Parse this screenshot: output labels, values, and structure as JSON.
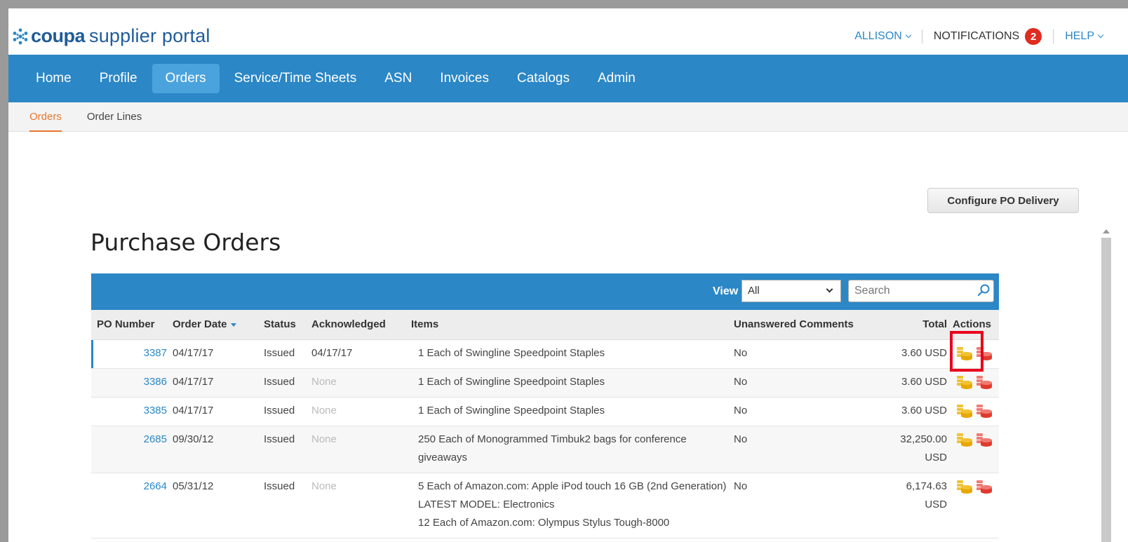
{
  "brand": {
    "logo_bold": "coupa",
    "logo_rest": "supplier portal"
  },
  "topnav": {
    "user": "ALLISON",
    "notifications_label": "NOTIFICATIONS",
    "notifications_count": "2",
    "help": "HELP"
  },
  "mainnav": {
    "tabs": [
      {
        "label": "Home",
        "active": false
      },
      {
        "label": "Profile",
        "active": false
      },
      {
        "label": "Orders",
        "active": true
      },
      {
        "label": "Service/Time Sheets",
        "active": false
      },
      {
        "label": "ASN",
        "active": false
      },
      {
        "label": "Invoices",
        "active": false
      },
      {
        "label": "Catalogs",
        "active": false
      },
      {
        "label": "Admin",
        "active": false
      }
    ]
  },
  "subnav": {
    "tabs": [
      {
        "label": "Orders",
        "active": true
      },
      {
        "label": "Order Lines",
        "active": false
      }
    ]
  },
  "configure_button": "Configure PO Delivery",
  "page_title": "Purchase Orders",
  "table": {
    "view_label": "View",
    "view_selected": "All",
    "search_placeholder": "Search",
    "columns": {
      "po_number": "PO Number",
      "order_date": "Order Date",
      "status": "Status",
      "acknowledged": "Acknowledged",
      "items": "Items",
      "unanswered": "Unanswered Comments",
      "total": "Total",
      "actions": "Actions"
    },
    "rows": [
      {
        "po": "3387",
        "date": "04/17/17",
        "status": "Issued",
        "ack": "04/17/17",
        "items": [
          "1 Each of Swingline Speedpoint Staples"
        ],
        "unanswered": "No",
        "total": "3.60 USD"
      },
      {
        "po": "3386",
        "date": "04/17/17",
        "status": "Issued",
        "ack": "None",
        "items": [
          "1 Each of Swingline Speedpoint Staples"
        ],
        "unanswered": "No",
        "total": "3.60 USD"
      },
      {
        "po": "3385",
        "date": "04/17/17",
        "status": "Issued",
        "ack": "None",
        "items": [
          "1 Each of Swingline Speedpoint Staples"
        ],
        "unanswered": "No",
        "total": "3.60 USD"
      },
      {
        "po": "2685",
        "date": "09/30/12",
        "status": "Issued",
        "ack": "None",
        "items": [
          "250 Each of Monogrammed Timbuk2 bags for conference giveaways"
        ],
        "unanswered": "No",
        "total": "32,250.00 USD"
      },
      {
        "po": "2664",
        "date": "05/31/12",
        "status": "Issued",
        "ack": "None",
        "items": [
          "5 Each of Amazon.com: Apple iPod touch 16 GB (2nd Generation) LATEST MODEL: Electronics",
          "12 Each of Amazon.com: Olympus Stylus Tough-8000"
        ],
        "unanswered": "No",
        "total": "6,174.63 USD"
      }
    ]
  },
  "colors": {
    "nav_blue": "#2b87c6",
    "active_tab": "#4aa3dd",
    "sub_active": "#e8772e",
    "badge_red": "#e02b20",
    "highlight_red": "#e8001c"
  }
}
